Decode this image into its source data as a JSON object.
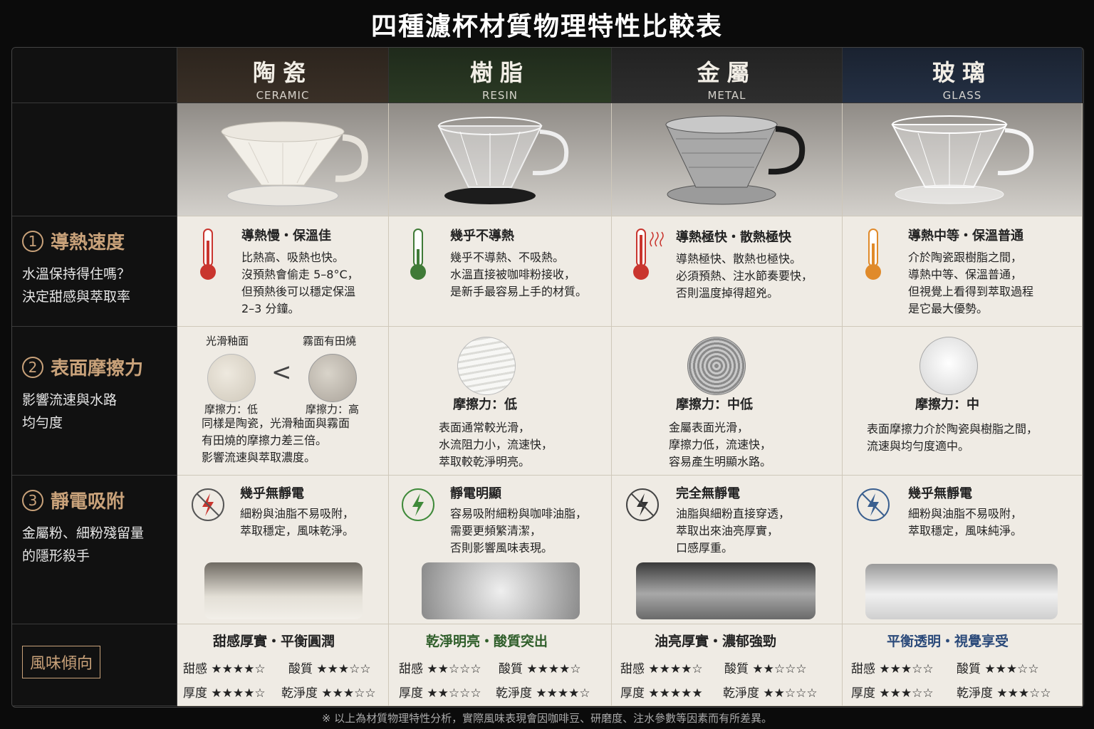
{
  "title": "四種濾杯材質物理特性比較表",
  "materials": [
    {
      "zh": "陶瓷",
      "en": "CERAMIC"
    },
    {
      "zh": "樹脂",
      "en": "RESIN"
    },
    {
      "zh": "金屬",
      "en": "METAL"
    },
    {
      "zh": "玻璃",
      "en": "GLASS"
    }
  ],
  "rows": {
    "r1": {
      "num": "1",
      "title": "導熱速度",
      "sub1": "水溫保持得住嗎？",
      "sub2": "決定甜感與萃取率"
    },
    "r2": {
      "num": "2",
      "title": "表面摩擦力",
      "sub1": "影響流速與水路",
      "sub2": "均勻度"
    },
    "r3": {
      "num": "3",
      "title": "靜電吸附",
      "sub1": "金屬粉、細粉殘留量",
      "sub2": "的隱形殺手"
    },
    "r4": {
      "tag": "風味傾向"
    }
  },
  "thermal": [
    {
      "head": "導熱慢・保溫佳",
      "l1": "比熱高、吸熱也快。",
      "l2": "沒預熱會偷走 5–8°C，",
      "l3": "但預熱後可以穩定保溫",
      "l4": "2–3 分鐘。"
    },
    {
      "head": "幾乎不導熱",
      "l1": "幾乎不導熱、不吸熱。",
      "l2": "水溫直接被咖啡粉接收，",
      "l3": "是新手最容易上手的材質。",
      "l4": ""
    },
    {
      "head": "導熱極快・散熱極快",
      "l1": "導熱極快、散熱也極快。",
      "l2": "必須預熱、注水節奏要快，",
      "l3": "否則溫度掉得超兇。",
      "l4": ""
    },
    {
      "head": "導熱中等・保溫普通",
      "l1": "介於陶瓷跟樹脂之間，",
      "l2": "導熱中等、保溫普通，",
      "l3": "但視覺上看得到萃取過程",
      "l4": "是它最大優勢。"
    }
  ],
  "friction": {
    "ceramic": {
      "glaze_label": "光滑釉面",
      "matte_label": "霧面有田燒",
      "less_than": "<",
      "glaze_fric": "摩擦力：低",
      "matte_fric": "摩擦力：高",
      "l1": "同樣是陶瓷，光滑釉面與霧面",
      "l2": "有田燒的摩擦力差三倍。",
      "l3": "影響流速與萃取濃度。"
    },
    "resin": {
      "fric": "摩擦力：低",
      "l1": "表面通常較光滑，",
      "l2": "水流阻力小，流速快，",
      "l3": "萃取較乾淨明亮。"
    },
    "metal": {
      "fric": "摩擦力：中低",
      "l1": "金屬表面光滑，",
      "l2": "摩擦力低，流速快，",
      "l3": "容易產生明顯水路。"
    },
    "glass": {
      "fric": "摩擦力：中",
      "l1": "表面摩擦力介於陶瓷與樹脂之間，",
      "l2": "流速與均勻度適中。",
      "l3": ""
    }
  },
  "static": [
    {
      "head": "幾乎無靜電",
      "l1": "細粉與油脂不易吸附，",
      "l2": "萃取穩定，風味乾淨。",
      "l3": ""
    },
    {
      "head": "靜電明顯",
      "l1": "容易吸附細粉與咖啡油脂，",
      "l2": "需要更頻繁清潔，",
      "l3": "否則影響風味表現。"
    },
    {
      "head": "完全無靜電",
      "l1": "油脂與細粉直接穿透，",
      "l2": "萃取出來油亮厚實，",
      "l3": "口感厚重。"
    },
    {
      "head": "幾乎無靜電",
      "l1": "細粉與油脂不易吸附，",
      "l2": "萃取穩定，風味純淨。",
      "l3": ""
    }
  ],
  "flavor": [
    {
      "head": "甜感厚實・平衡圓潤",
      "color": "#222222",
      "a": "甜感 ★★★★☆",
      "b": "酸質 ★★★☆☆",
      "c": "厚度 ★★★★☆",
      "d": "乾淨度 ★★★☆☆"
    },
    {
      "head": "乾淨明亮・酸質突出",
      "color": "#2f5e2a",
      "a": "甜感 ★★☆☆☆",
      "b": "酸質 ★★★★☆",
      "c": "厚度 ★★☆☆☆",
      "d": "乾淨度 ★★★★☆"
    },
    {
      "head": "油亮厚實・濃郁強勁",
      "color": "#222222",
      "a": "甜感 ★★★★☆",
      "b": "酸質 ★★☆☆☆",
      "c": "厚度 ★★★★★",
      "d": "乾淨度 ★★☆☆☆"
    },
    {
      "head": "平衡透明・視覺享受",
      "color": "#2b4a7a",
      "a": "甜感 ★★★☆☆",
      "b": "酸質 ★★★☆☆",
      "c": "厚度 ★★★☆☆",
      "d": "乾淨度 ★★★☆☆"
    }
  ],
  "footer": "※ 以上為材質物理特性分析，實際風味表現會因咖啡豆、研磨度、注水參數等因素而有所差異。",
  "colors": {
    "accent": "#c9a27a",
    "thermo_red": "#c9352e",
    "thermo_green": "#3f7a37",
    "thermo_orange": "#e08a2a",
    "static_resin": "#3f8a3a",
    "static_glass": "#3a5f8f"
  }
}
